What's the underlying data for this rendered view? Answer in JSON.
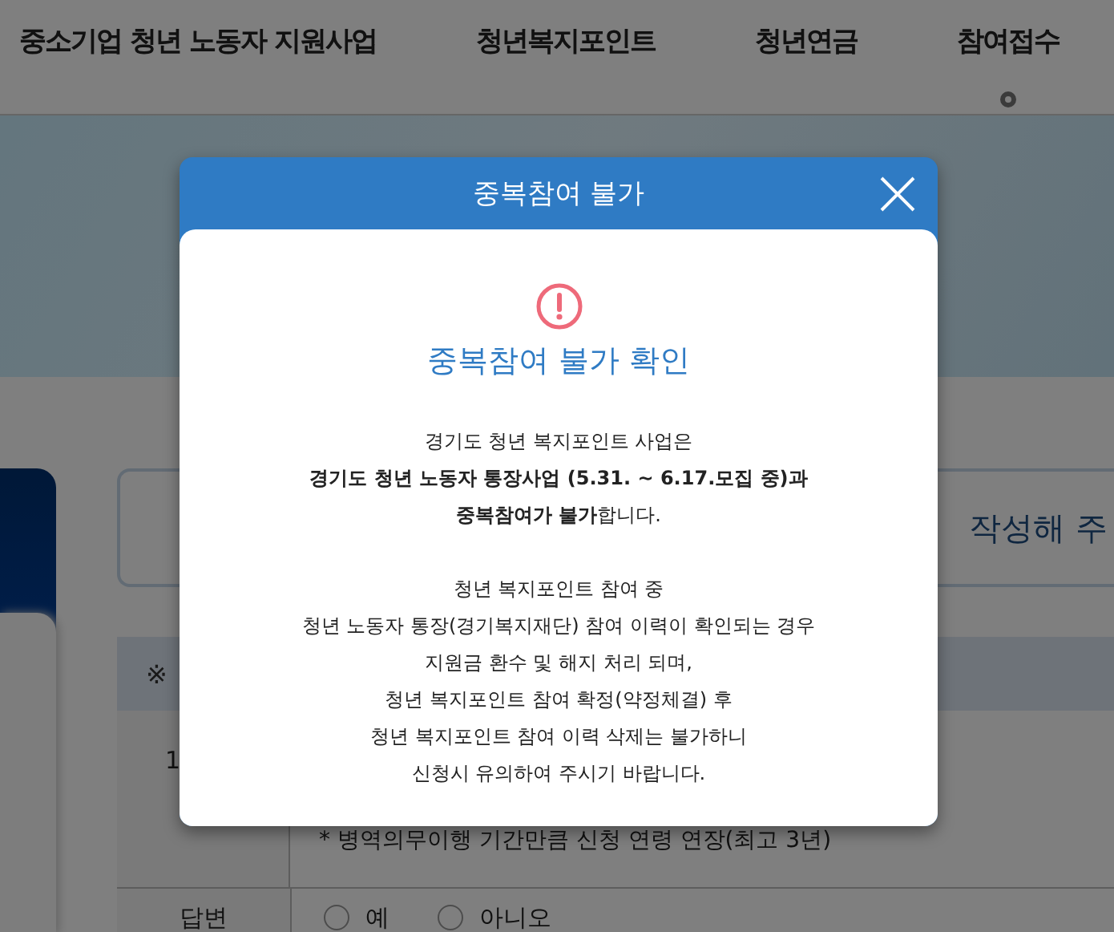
{
  "nav": {
    "items": [
      {
        "label": "중소기업 청년 노동자 지원사업",
        "selected": false
      },
      {
        "label": "청년복지포인트",
        "selected": false
      },
      {
        "label": "청년연금",
        "selected": false
      },
      {
        "label": "참여접수",
        "selected": true
      }
    ]
  },
  "notice_box": {
    "text": "작성해 주"
  },
  "table": {
    "header": "※",
    "rows": [
      {
        "number": "1",
        "note": "* 병역의무이행 기간만큼 신청 연령 연장(최고 3년)"
      }
    ],
    "answer": {
      "label": "답변",
      "options": [
        {
          "label": "예",
          "selected": false
        },
        {
          "label": "아니오",
          "selected": false
        }
      ]
    }
  },
  "dialog": {
    "title": "중복참여 불가",
    "heading": "중복참여 불가 확인",
    "paragraphs": [
      [
        "경기도 청년 복지포인트 사업은",
        "**경기도 청년 노동자 통장사업 (5.31. ~ 6.17.모집 중)과**",
        "**중복참여가 불가**합니다."
      ],
      [
        "청년 복지포인트 참여 중",
        "청년 노동자 통장(경기복지재단) 참여 이력이 확인되는 경우",
        "지원금 환수 및 해지 처리 되며,",
        "청년 복지포인트 참여 확정(약정체결) 후",
        "청년 복지포인트 참여 이력 삭제는 불가하니",
        "신청시 유의하여 주시기 바랍니다."
      ]
    ]
  }
}
